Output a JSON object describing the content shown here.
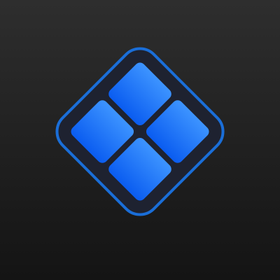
{
  "logo": {
    "icon": "diamond-grid-icon",
    "colors": {
      "background_top": "#2e2e2e",
      "background_bottom": "#141414",
      "frame_fill": "#1e2230",
      "frame_stroke": "#1a6ed8",
      "tile_top": "#3d94ff",
      "tile_bottom": "#0a5cf0"
    }
  }
}
